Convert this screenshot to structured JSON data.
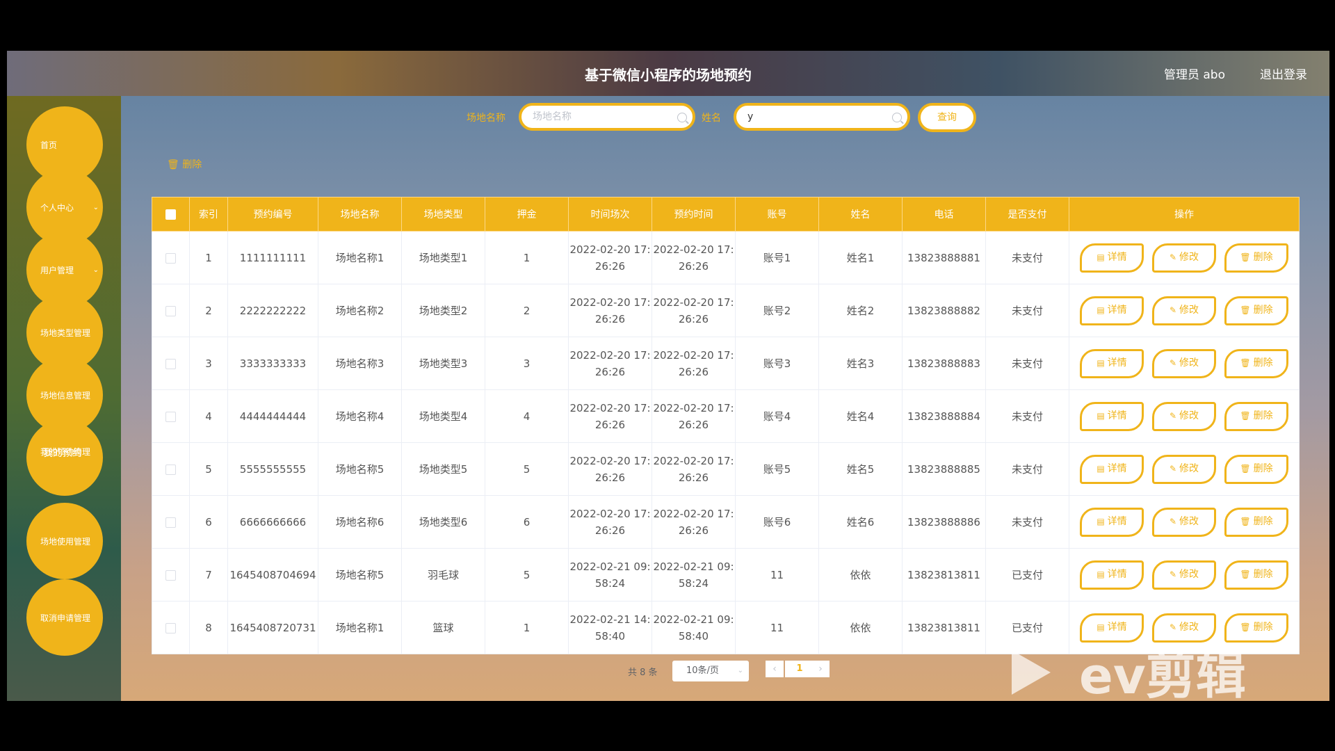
{
  "header": {
    "title": "基于微信小程序的场地预约",
    "user": "管理员 abo",
    "logout": "退出登录"
  },
  "sidebar": {
    "items": [
      {
        "label": "首页",
        "chevron": ""
      },
      {
        "label": "个人中心",
        "chevron": "⌄"
      },
      {
        "label": "用户管理",
        "chevron": "⌄"
      },
      {
        "label": "场地类型管理",
        "chevron": ""
      },
      {
        "label": "场地信息管理",
        "chevron": ""
      },
      {
        "label": "我的预约管理",
        "chevron": ""
      },
      {
        "label": "场地使用管理",
        "chevron": ""
      },
      {
        "label": "取消申请管理",
        "chevron": ""
      }
    ],
    "sub_item": "我的预约"
  },
  "search": {
    "venue_label": "场地名称",
    "venue_placeholder": "场地名称",
    "venue_value": "",
    "name_label": "姓名",
    "name_placeholder": "",
    "name_value": "y",
    "query_button": "查询"
  },
  "toolbar": {
    "bulk_delete": "删除",
    "bulk_delete_icon": "trash-icon"
  },
  "table": {
    "headers": [
      "",
      "索引",
      "预约编号",
      "场地名称",
      "场地类型",
      "押金",
      "时间场次",
      "预约时间",
      "账号",
      "姓名",
      "电话",
      "是否支付",
      "操作"
    ],
    "rows": [
      {
        "index": "1",
        "code": "1111111111",
        "venue": "场地名称1",
        "type": "场地类型1",
        "deposit": "1",
        "session": "2022-02-20 17:26:26",
        "booked": "2022-02-20 17:26:26",
        "account": "账号1",
        "name": "姓名1",
        "phone": "13823888881",
        "paid": "未支付"
      },
      {
        "index": "2",
        "code": "2222222222",
        "venue": "场地名称2",
        "type": "场地类型2",
        "deposit": "2",
        "session": "2022-02-20 17:26:26",
        "booked": "2022-02-20 17:26:26",
        "account": "账号2",
        "name": "姓名2",
        "phone": "13823888882",
        "paid": "未支付"
      },
      {
        "index": "3",
        "code": "3333333333",
        "venue": "场地名称3",
        "type": "场地类型3",
        "deposit": "3",
        "session": "2022-02-20 17:26:26",
        "booked": "2022-02-20 17:26:26",
        "account": "账号3",
        "name": "姓名3",
        "phone": "13823888883",
        "paid": "未支付"
      },
      {
        "index": "4",
        "code": "4444444444",
        "venue": "场地名称4",
        "type": "场地类型4",
        "deposit": "4",
        "session": "2022-02-20 17:26:26",
        "booked": "2022-02-20 17:26:26",
        "account": "账号4",
        "name": "姓名4",
        "phone": "13823888884",
        "paid": "未支付"
      },
      {
        "index": "5",
        "code": "5555555555",
        "venue": "场地名称5",
        "type": "场地类型5",
        "deposit": "5",
        "session": "2022-02-20 17:26:26",
        "booked": "2022-02-20 17:26:26",
        "account": "账号5",
        "name": "姓名5",
        "phone": "13823888885",
        "paid": "未支付"
      },
      {
        "index": "6",
        "code": "6666666666",
        "venue": "场地名称6",
        "type": "场地类型6",
        "deposit": "6",
        "session": "2022-02-20 17:26:26",
        "booked": "2022-02-20 17:26:26",
        "account": "账号6",
        "name": "姓名6",
        "phone": "13823888886",
        "paid": "未支付"
      },
      {
        "index": "7",
        "code": "1645408704694",
        "venue": "场地名称5",
        "type": "羽毛球",
        "deposit": "5",
        "session": "2022-02-21 09:58:24",
        "booked": "2022-02-21 09:58:24",
        "account": "11",
        "name": "依依",
        "phone": "13823813811",
        "paid": "已支付"
      },
      {
        "index": "8",
        "code": "1645408720731",
        "venue": "场地名称1",
        "type": "篮球",
        "deposit": "1",
        "session": "2022-02-21 14:58:40",
        "booked": "2022-02-21 09:58:40",
        "account": "11",
        "name": "依依",
        "phone": "13823813811",
        "paid": "已支付"
      }
    ],
    "actions": [
      {
        "label": "详情",
        "icon": "document-icon",
        "glyph": "▤"
      },
      {
        "label": "修改",
        "icon": "edit-icon",
        "glyph": "✎"
      },
      {
        "label": "删除",
        "icon": "trash-icon",
        "glyph": "🗑"
      }
    ]
  },
  "pagination": {
    "total": "共 8 条",
    "page_size": "10条/页",
    "prev": "‹",
    "current": "1",
    "next": "›"
  },
  "watermark": {
    "text": "ev剪辑"
  },
  "colors": {
    "accent": "#f0b41a",
    "table_header": "#f0b41a",
    "text": "#555555"
  }
}
